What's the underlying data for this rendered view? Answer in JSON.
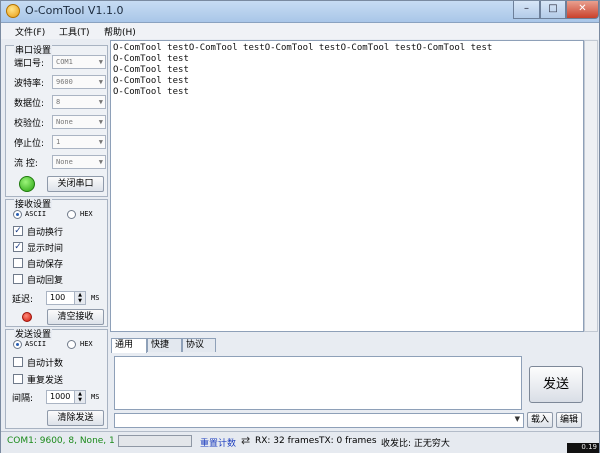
{
  "window": {
    "title": "O-ComTool V1.1.0",
    "min": "–",
    "max": "□",
    "close": "✕"
  },
  "menu": [
    "文件(F)",
    "工具(T)",
    "帮助(H)"
  ],
  "serial": {
    "title": "串口设置",
    "fields": [
      {
        "label": "端口号:",
        "value": "COM1"
      },
      {
        "label": "波特率:",
        "value": "9600"
      },
      {
        "label": "数据位:",
        "value": "8"
      },
      {
        "label": "校验位:",
        "value": "None"
      },
      {
        "label": "停止位:",
        "value": "1"
      },
      {
        "label": "流  控:",
        "value": "None"
      }
    ],
    "close_button": "关闭串口",
    "indicator_color": "#28a311"
  },
  "receive": {
    "title": "接收设置",
    "modes": [
      "ASCII",
      "HEX"
    ],
    "selected_mode": "ASCII",
    "options": [
      {
        "label": "自动换行",
        "checked": true
      },
      {
        "label": "显示时间",
        "checked": true
      },
      {
        "label": "自动保存",
        "checked": false
      },
      {
        "label": "自动回复",
        "checked": false
      }
    ],
    "delay_label": "延迟:",
    "delay_value": "100",
    "delay_unit": "MS",
    "clear_button": "清空接收",
    "indicator_color": "#d0170a"
  },
  "send_settings": {
    "title": "发送设置",
    "modes": [
      "ASCII",
      "HEX"
    ],
    "selected_mode": "ASCII",
    "options": [
      {
        "label": "自动计数",
        "checked": false
      },
      {
        "label": "重复发送",
        "checked": false
      }
    ],
    "interval_label": "间隔:",
    "interval_value": "1000",
    "interval_unit": "MS",
    "clear_button": "清除发送"
  },
  "receive_text": [
    "O-ComTool testO-ComTool testO-ComTool testO-ComTool testO-ComTool test",
    "O-ComTool test",
    "O-ComTool test",
    "O-ComTool test",
    "O-ComTool test"
  ],
  "tabs": [
    "通用",
    "快捷",
    "协议"
  ],
  "send_button": "发送",
  "load_button": "载入",
  "edit_button": "编辑",
  "status": {
    "port_info": "COM1: 9600, 8, None, 1",
    "reset_count": "重置计数",
    "rx": "RX: 32 frames",
    "tx": "TX: 0 frames",
    "ratio": "收发比: 正无穷大",
    "corner": "0.19",
    "progress": 0
  }
}
